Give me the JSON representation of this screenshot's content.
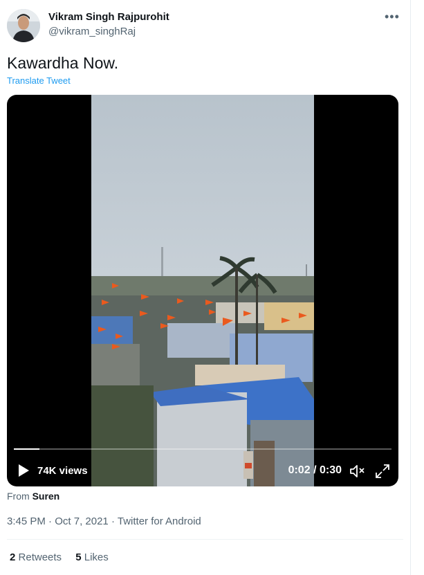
{
  "author": {
    "name": "Vikram Singh Rajpurohit",
    "handle": "@vikram_singhRaj"
  },
  "more_icon": "more-horizontal-icon",
  "tweet": {
    "text": "Kawardha Now.",
    "translate_label": "Translate Tweet"
  },
  "video": {
    "views": "74K views",
    "current_time": "0:02",
    "time_separator": "/",
    "duration": "0:30",
    "progress": 0.067,
    "icons": [
      "play-icon",
      "mute-icon",
      "fullscreen-icon"
    ]
  },
  "source": {
    "prefix": "From",
    "name": "Suren"
  },
  "meta": {
    "time": "3:45 PM",
    "date": "Oct 7, 2021",
    "client": "Twitter for Android",
    "separator": "·"
  },
  "stats": {
    "retweets_count": "2",
    "retweets_label": "Retweets",
    "likes_count": "5",
    "likes_label": "Likes"
  },
  "colors": {
    "link": "#1d9bf0",
    "secondary_text": "#536471",
    "primary_text": "#0f1419"
  }
}
